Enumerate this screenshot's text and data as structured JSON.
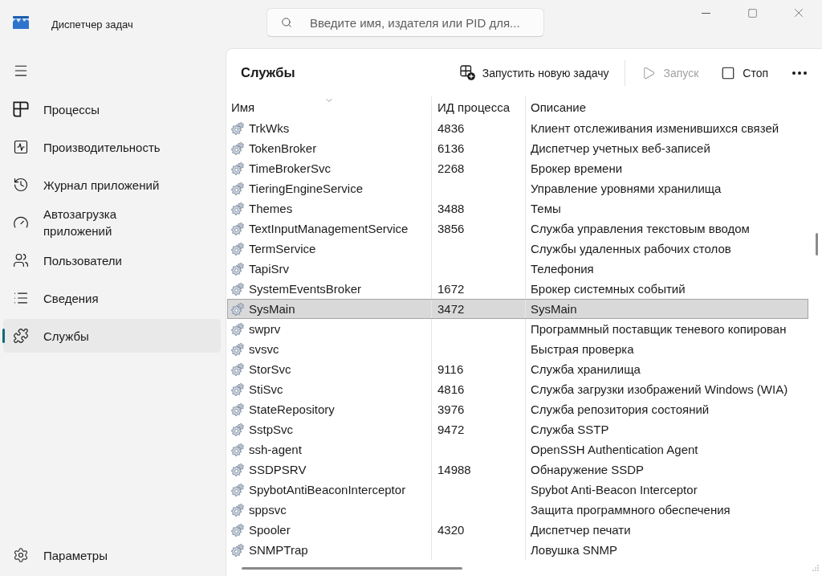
{
  "window": {
    "title": "Диспетчер задач"
  },
  "search": {
    "placeholder": "Введите имя, издателя или PID для..."
  },
  "sidebar": {
    "items": [
      {
        "label": "Процессы",
        "selected": false
      },
      {
        "label": "Производительность",
        "selected": false
      },
      {
        "label": "Журнал приложений",
        "selected": false
      },
      {
        "label": "Автозагрузка приложений",
        "selected": false
      },
      {
        "label": "Пользователи",
        "selected": false
      },
      {
        "label": "Сведения",
        "selected": false
      },
      {
        "label": "Службы",
        "selected": true
      }
    ],
    "footer_items": [
      {
        "label": "Параметры",
        "selected": false
      }
    ]
  },
  "page": {
    "title": "Службы"
  },
  "toolbar": {
    "buttons": [
      {
        "label": "Запустить новую задачу",
        "disabled": false
      },
      {
        "label": "Запуск",
        "disabled": true
      },
      {
        "label": "Стоп",
        "disabled": false
      }
    ]
  },
  "table": {
    "columns": [
      {
        "label": "Имя",
        "sorted": true
      },
      {
        "label": "ИД процесса",
        "sorted": false
      },
      {
        "label": "Описание",
        "sorted": false
      }
    ],
    "rows": [
      {
        "name": "TrkWks",
        "pid": "4836",
        "description": "Клиент отслеживания изменившихся связей",
        "selected": false
      },
      {
        "name": "TokenBroker",
        "pid": "6136",
        "description": "Диспетчер учетных веб-записей",
        "selected": false
      },
      {
        "name": "TimeBrokerSvc",
        "pid": "2268",
        "description": "Брокер времени",
        "selected": false
      },
      {
        "name": "TieringEngineService",
        "description": "Управление уровнями хранилища",
        "selected": false
      },
      {
        "name": "Themes",
        "pid": "3488",
        "description": "Темы",
        "selected": false
      },
      {
        "name": "TextInputManagementService",
        "pid": "3856",
        "description": "Служба управления текстовым вводом",
        "selected": false
      },
      {
        "name": "TermService",
        "description": "Службы удаленных рабочих столов",
        "selected": false
      },
      {
        "name": "TapiSrv",
        "description": "Телефония",
        "selected": false
      },
      {
        "name": "SystemEventsBroker",
        "pid": "1672",
        "description": "Брокер системных событий",
        "selected": false
      },
      {
        "name": "SysMain",
        "pid": "3472",
        "description": "SysMain",
        "selected": true
      },
      {
        "name": "swprv",
        "description": "Программный поставщик теневого копирован",
        "selected": false
      },
      {
        "name": "svsvc",
        "description": "Быстрая проверка",
        "selected": false
      },
      {
        "name": "StorSvc",
        "pid": "9116",
        "description": "Служба хранилища",
        "selected": false
      },
      {
        "name": "StiSvc",
        "pid": "4816",
        "description": "Служба загрузки изображений Windows (WIA)",
        "selected": false
      },
      {
        "name": "StateRepository",
        "pid": "3976",
        "description": "Служба репозитория состояний",
        "selected": false
      },
      {
        "name": "SstpSvc",
        "pid": "9472",
        "description": "Служба SSTP",
        "selected": false
      },
      {
        "name": "ssh-agent",
        "description": "OpenSSH Authentication Agent",
        "selected": false
      },
      {
        "name": "SSDPSRV",
        "pid": "14988",
        "description": "Обнаружение SSDP",
        "selected": false
      },
      {
        "name": "SpybotAntiBeaconInterceptor",
        "description": "Spybot Anti-Beacon Interceptor",
        "selected": false
      },
      {
        "name": "sppsvc",
        "description": "Защита программного обеспечения",
        "selected": false
      },
      {
        "name": "Spooler",
        "pid": "4320",
        "description": "Диспетчер печати",
        "selected": false
      },
      {
        "name": "SNMPTrap",
        "description": "Ловушка SNMP",
        "selected": false
      }
    ]
  }
}
